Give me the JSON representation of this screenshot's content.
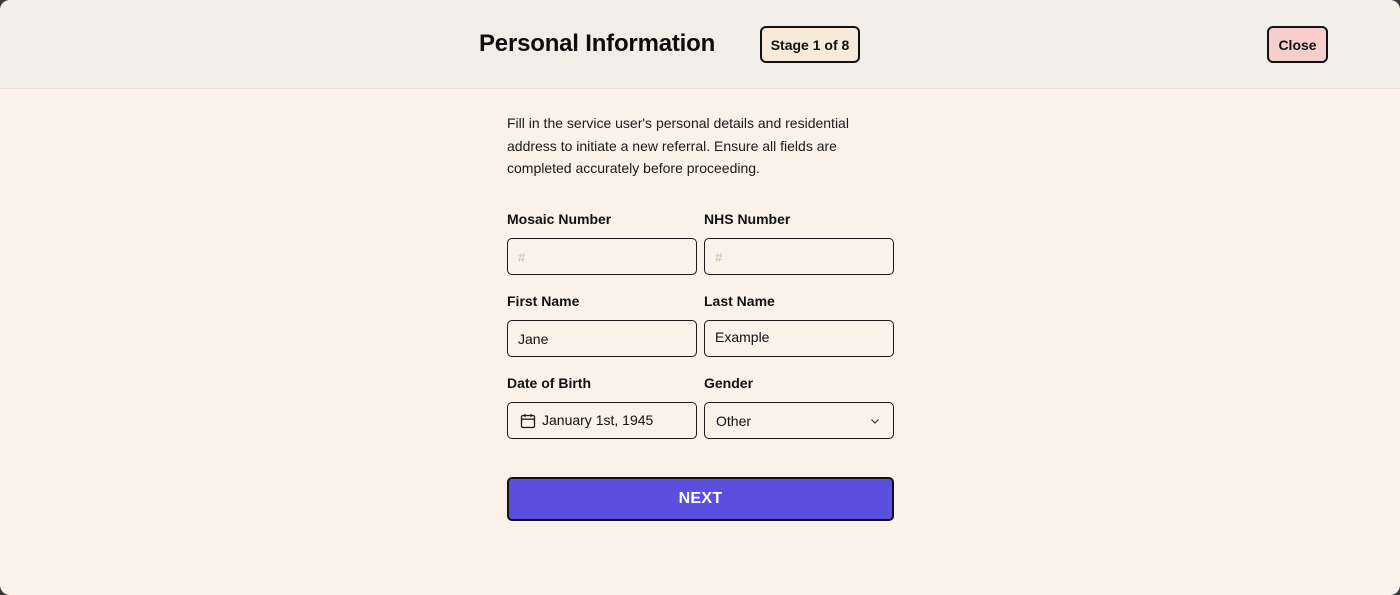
{
  "header": {
    "title": "Personal Information",
    "stage_badge": "Stage 1 of 8",
    "close_label": "Close"
  },
  "intro_text": "Fill in the service user's personal details and residential address to initiate a new referral. Ensure all fields are completed accurately before proceeding.",
  "form": {
    "mosaic_number": {
      "label": "Mosaic Number",
      "placeholder": "#",
      "value": ""
    },
    "nhs_number": {
      "label": "NHS Number",
      "placeholder": "#",
      "value": ""
    },
    "first_name": {
      "label": "First Name",
      "value": "Jane"
    },
    "last_name": {
      "label": "Last Name",
      "value": "Example"
    },
    "date_of_birth": {
      "label": "Date of Birth",
      "value": "January 1st, 1945",
      "icon": "calendar-icon"
    },
    "gender": {
      "label": "Gender",
      "value": "Other",
      "icon": "chevron-down-icon"
    }
  },
  "next_label": "NEXT",
  "colors": {
    "page_background": "#faf1e8",
    "header_background": "#f1ede7",
    "stage_badge_background": "#f8ead8",
    "close_button_background": "#f6cfcd",
    "primary_button": "#5b4fdf"
  }
}
